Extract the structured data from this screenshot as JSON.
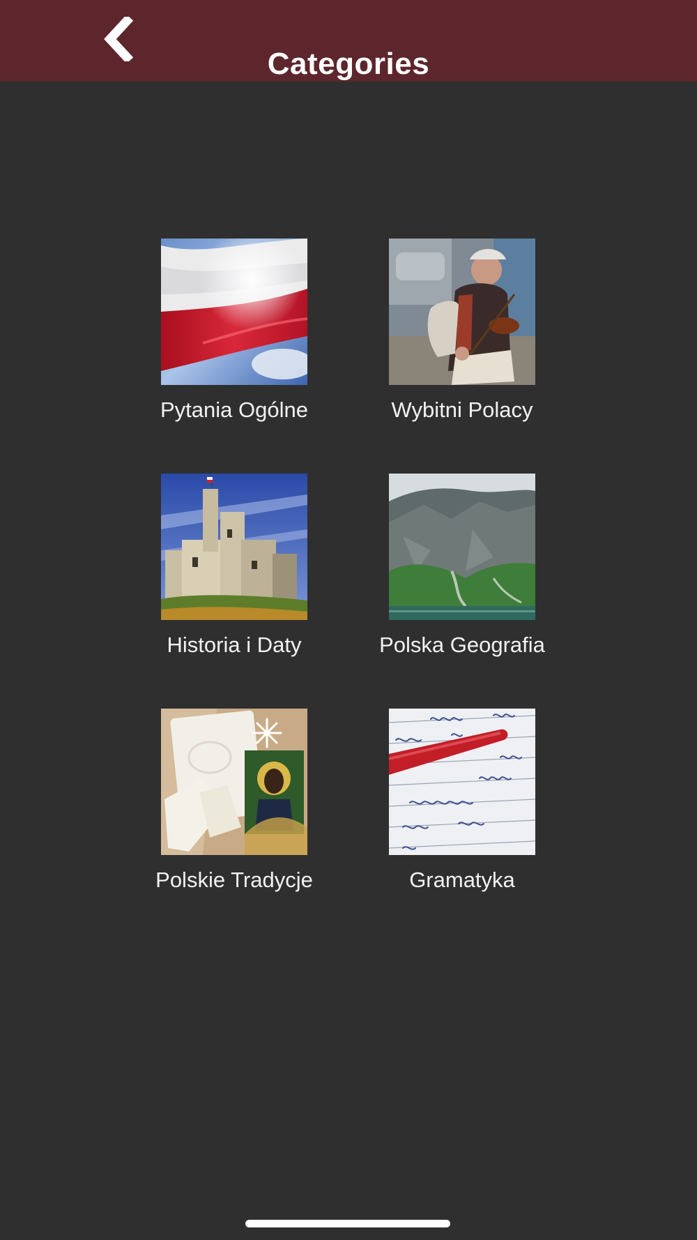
{
  "header": {
    "title": "Categories",
    "back_icon": "chevron-left-icon",
    "background_color": "#5c262c"
  },
  "categories": [
    {
      "label": "Pytania Ogólne",
      "image": "polish-flag-image"
    },
    {
      "label": "Wybitni Polacy",
      "image": "violinist-image"
    },
    {
      "label": "Historia i Daty",
      "image": "castle-ruins-image"
    },
    {
      "label": "Polska Geografia",
      "image": "mountain-lake-image"
    },
    {
      "label": "Polskie Tradycje",
      "image": "christmas-wafer-image"
    },
    {
      "label": "Gramatyka",
      "image": "handwriting-pen-image"
    }
  ],
  "colors": {
    "background": "#2f2f2f",
    "text": "#f2f2f2"
  }
}
